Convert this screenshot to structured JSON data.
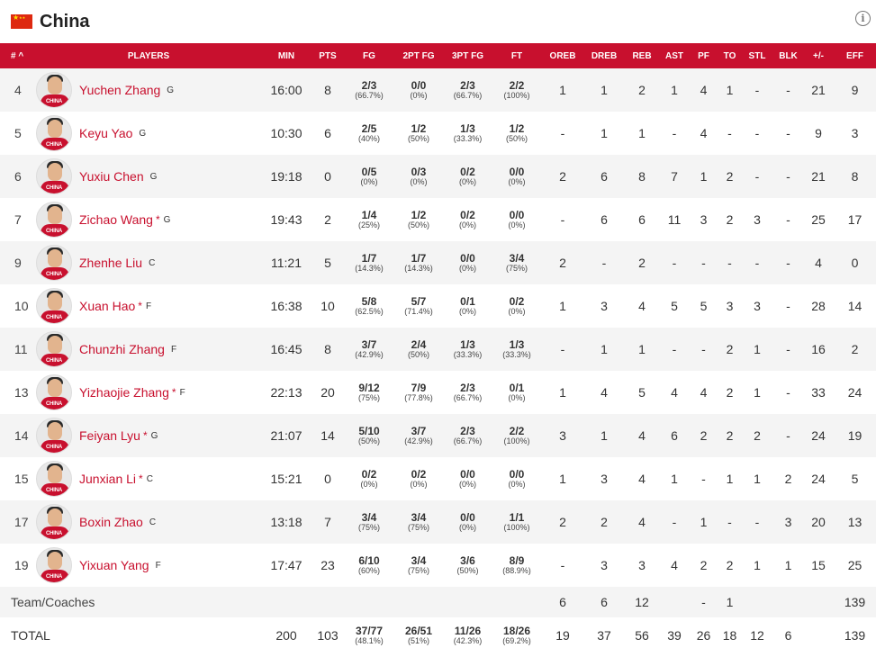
{
  "team": {
    "name": "China",
    "flag": "china-flag"
  },
  "info_icon": "i",
  "columns": [
    "# ^",
    "PLAYERS",
    "MIN",
    "PTS",
    "FG",
    "2PT FG",
    "3PT FG",
    "FT",
    "OREB",
    "DREB",
    "REB",
    "AST",
    "PF",
    "TO",
    "STL",
    "BLK",
    "+/-",
    "EFF"
  ],
  "avatar_text": "CHINA",
  "players": [
    {
      "num": "4",
      "name": "Yuchen Zhang",
      "starter": false,
      "pos": "G",
      "min": "16:00",
      "pts": "8",
      "fg": "2/3",
      "fg_pct": "(66.7%)",
      "fg2": "0/0",
      "fg2_pct": "(0%)",
      "fg3": "2/3",
      "fg3_pct": "(66.7%)",
      "ft": "2/2",
      "ft_pct": "(100%)",
      "oreb": "1",
      "dreb": "1",
      "reb": "2",
      "ast": "1",
      "pf": "4",
      "to": "1",
      "stl": "-",
      "blk": "-",
      "pm": "21",
      "eff": "9"
    },
    {
      "num": "5",
      "name": "Keyu Yao",
      "starter": false,
      "pos": "G",
      "min": "10:30",
      "pts": "6",
      "fg": "2/5",
      "fg_pct": "(40%)",
      "fg2": "1/2",
      "fg2_pct": "(50%)",
      "fg3": "1/3",
      "fg3_pct": "(33.3%)",
      "ft": "1/2",
      "ft_pct": "(50%)",
      "oreb": "-",
      "dreb": "1",
      "reb": "1",
      "ast": "-",
      "pf": "4",
      "to": "-",
      "stl": "-",
      "blk": "-",
      "pm": "9",
      "eff": "3"
    },
    {
      "num": "6",
      "name": "Yuxiu Chen",
      "starter": false,
      "pos": "G",
      "min": "19:18",
      "pts": "0",
      "fg": "0/5",
      "fg_pct": "(0%)",
      "fg2": "0/3",
      "fg2_pct": "(0%)",
      "fg3": "0/2",
      "fg3_pct": "(0%)",
      "ft": "0/0",
      "ft_pct": "(0%)",
      "oreb": "2",
      "dreb": "6",
      "reb": "8",
      "ast": "7",
      "pf": "1",
      "to": "2",
      "stl": "-",
      "blk": "-",
      "pm": "21",
      "eff": "8"
    },
    {
      "num": "7",
      "name": "Zichao Wang",
      "starter": true,
      "pos": "G",
      "min": "19:43",
      "pts": "2",
      "fg": "1/4",
      "fg_pct": "(25%)",
      "fg2": "1/2",
      "fg2_pct": "(50%)",
      "fg3": "0/2",
      "fg3_pct": "(0%)",
      "ft": "0/0",
      "ft_pct": "(0%)",
      "oreb": "-",
      "dreb": "6",
      "reb": "6",
      "ast": "11",
      "pf": "3",
      "to": "2",
      "stl": "3",
      "blk": "-",
      "pm": "25",
      "eff": "17"
    },
    {
      "num": "9",
      "name": "Zhenhe Liu",
      "starter": false,
      "pos": "C",
      "min": "11:21",
      "pts": "5",
      "fg": "1/7",
      "fg_pct": "(14.3%)",
      "fg2": "1/7",
      "fg2_pct": "(14.3%)",
      "fg3": "0/0",
      "fg3_pct": "(0%)",
      "ft": "3/4",
      "ft_pct": "(75%)",
      "oreb": "2",
      "dreb": "-",
      "reb": "2",
      "ast": "-",
      "pf": "-",
      "to": "-",
      "stl": "-",
      "blk": "-",
      "pm": "4",
      "eff": "0"
    },
    {
      "num": "10",
      "name": "Xuan Hao",
      "starter": true,
      "pos": "F",
      "min": "16:38",
      "pts": "10",
      "fg": "5/8",
      "fg_pct": "(62.5%)",
      "fg2": "5/7",
      "fg2_pct": "(71.4%)",
      "fg3": "0/1",
      "fg3_pct": "(0%)",
      "ft": "0/2",
      "ft_pct": "(0%)",
      "oreb": "1",
      "dreb": "3",
      "reb": "4",
      "ast": "5",
      "pf": "5",
      "to": "3",
      "stl": "3",
      "blk": "-",
      "pm": "28",
      "eff": "14"
    },
    {
      "num": "11",
      "name": "Chunzhi Zhang",
      "starter": false,
      "pos": "F",
      "min": "16:45",
      "pts": "8",
      "fg": "3/7",
      "fg_pct": "(42.9%)",
      "fg2": "2/4",
      "fg2_pct": "(50%)",
      "fg3": "1/3",
      "fg3_pct": "(33.3%)",
      "ft": "1/3",
      "ft_pct": "(33.3%)",
      "oreb": "-",
      "dreb": "1",
      "reb": "1",
      "ast": "-",
      "pf": "-",
      "to": "2",
      "stl": "1",
      "blk": "-",
      "pm": "16",
      "eff": "2"
    },
    {
      "num": "13",
      "name": "Yizhaojie Zhang",
      "starter": true,
      "pos": "F",
      "min": "22:13",
      "pts": "20",
      "fg": "9/12",
      "fg_pct": "(75%)",
      "fg2": "7/9",
      "fg2_pct": "(77.8%)",
      "fg3": "2/3",
      "fg3_pct": "(66.7%)",
      "ft": "0/1",
      "ft_pct": "(0%)",
      "oreb": "1",
      "dreb": "4",
      "reb": "5",
      "ast": "4",
      "pf": "4",
      "to": "2",
      "stl": "1",
      "blk": "-",
      "pm": "33",
      "eff": "24"
    },
    {
      "num": "14",
      "name": "Feiyan Lyu",
      "starter": true,
      "pos": "G",
      "min": "21:07",
      "pts": "14",
      "fg": "5/10",
      "fg_pct": "(50%)",
      "fg2": "3/7",
      "fg2_pct": "(42.9%)",
      "fg3": "2/3",
      "fg3_pct": "(66.7%)",
      "ft": "2/2",
      "ft_pct": "(100%)",
      "oreb": "3",
      "dreb": "1",
      "reb": "4",
      "ast": "6",
      "pf": "2",
      "to": "2",
      "stl": "2",
      "blk": "-",
      "pm": "24",
      "eff": "19"
    },
    {
      "num": "15",
      "name": "Junxian Li",
      "starter": true,
      "pos": "C",
      "min": "15:21",
      "pts": "0",
      "fg": "0/2",
      "fg_pct": "(0%)",
      "fg2": "0/2",
      "fg2_pct": "(0%)",
      "fg3": "0/0",
      "fg3_pct": "(0%)",
      "ft": "0/0",
      "ft_pct": "(0%)",
      "oreb": "1",
      "dreb": "3",
      "reb": "4",
      "ast": "1",
      "pf": "-",
      "to": "1",
      "stl": "1",
      "blk": "2",
      "pm": "24",
      "eff": "5"
    },
    {
      "num": "17",
      "name": "Boxin Zhao",
      "starter": false,
      "pos": "C",
      "min": "13:18",
      "pts": "7",
      "fg": "3/4",
      "fg_pct": "(75%)",
      "fg2": "3/4",
      "fg2_pct": "(75%)",
      "fg3": "0/0",
      "fg3_pct": "(0%)",
      "ft": "1/1",
      "ft_pct": "(100%)",
      "oreb": "2",
      "dreb": "2",
      "reb": "4",
      "ast": "-",
      "pf": "1",
      "to": "-",
      "stl": "-",
      "blk": "3",
      "pm": "20",
      "eff": "13"
    },
    {
      "num": "19",
      "name": "Yixuan Yang",
      "starter": false,
      "pos": "F",
      "min": "17:47",
      "pts": "23",
      "fg": "6/10",
      "fg_pct": "(60%)",
      "fg2": "3/4",
      "fg2_pct": "(75%)",
      "fg3": "3/6",
      "fg3_pct": "(50%)",
      "ft": "8/9",
      "ft_pct": "(88.9%)",
      "oreb": "-",
      "dreb": "3",
      "reb": "3",
      "ast": "4",
      "pf": "2",
      "to": "2",
      "stl": "1",
      "blk": "1",
      "pm": "15",
      "eff": "25"
    }
  ],
  "team_row": {
    "label": "Team/Coaches",
    "oreb": "6",
    "dreb": "6",
    "reb": "12",
    "ast": "",
    "pf": "-",
    "to": "1",
    "stl": "",
    "blk": "",
    "pm": "",
    "eff": "139"
  },
  "total_row": {
    "label": "TOTAL",
    "min": "200",
    "pts": "103",
    "fg": "37/77",
    "fg_pct": "(48.1%)",
    "fg2": "26/51",
    "fg2_pct": "(51%)",
    "fg3": "11/26",
    "fg3_pct": "(42.3%)",
    "ft": "18/26",
    "ft_pct": "(69.2%)",
    "oreb": "19",
    "dreb": "37",
    "reb": "56",
    "ast": "39",
    "pf": "26",
    "to": "18",
    "stl": "12",
    "blk": "6",
    "pm": "",
    "eff": "139"
  },
  "colors": {
    "accent": "#c8102e",
    "stripe": "#f4f4f4"
  }
}
